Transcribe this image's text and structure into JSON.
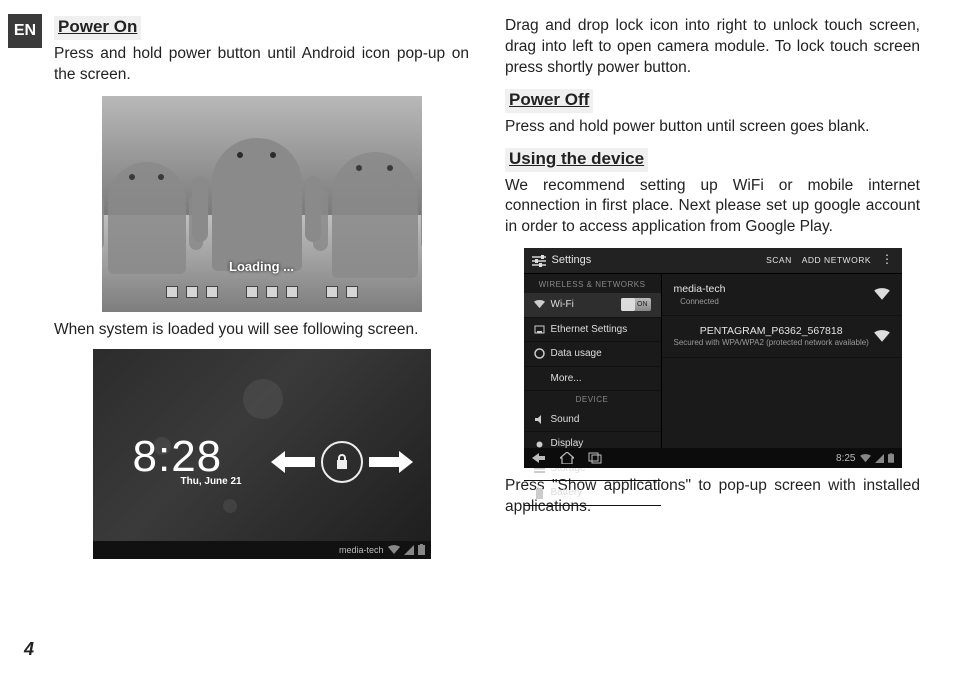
{
  "lang_tab": "EN",
  "page_number": "4",
  "left": {
    "h1": "Power On",
    "p1": "Press and hold power button until Android icon pop-up on the screen.",
    "fig1": {
      "loading_label": "Loading ..."
    },
    "caption2": "When system is loaded you will see following screen.",
    "fig2": {
      "clock": "8:28",
      "date": "Thu, June 21",
      "brand": "media-tech"
    }
  },
  "right": {
    "p_top": "Drag and drop lock icon into right to unlock touch screen, drag into left to open camera module. To lock touch screen press shortly power button.",
    "h2": "Power Off",
    "p2": "Press and hold power button until screen goes blank.",
    "h3": "Using the device",
    "p3": "We recommend setting up WiFi or mobile internet connection in first place. Next please set up google account in order to access application from Google Play.",
    "fig3": {
      "title": "Settings",
      "actions": {
        "scan": "SCAN",
        "add": "ADD NETWORK"
      },
      "categories": {
        "wireless": "WIRELESS & NETWORKS",
        "device": "DEVICE"
      },
      "side": {
        "wifi": "Wi-Fi",
        "wifi_toggle": "ON",
        "ethernet": "Ethernet Settings",
        "data": "Data usage",
        "more": "More...",
        "sound": "Sound",
        "display": "Display",
        "storage": "Storage",
        "battery": "Battery"
      },
      "networks": [
        {
          "name": "media-tech",
          "sub": "Connected"
        },
        {
          "name": "PENTAGRAM_P6362_567818",
          "sub": "Secured with WPA/WPA2 (protected network available)"
        }
      ],
      "nav_time": "8:25"
    },
    "p_bottom": "Press \"Show applications\" to pop-up screen with installed applications."
  }
}
